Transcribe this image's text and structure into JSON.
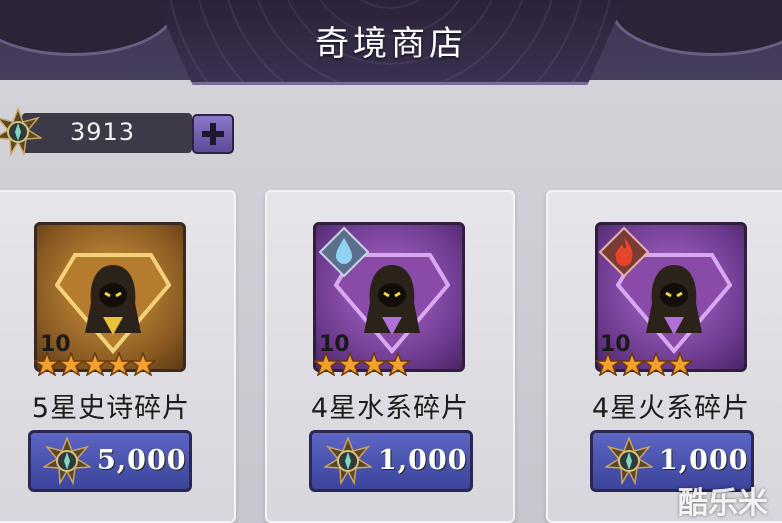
{
  "header": {
    "title": "奇境商店"
  },
  "currency": {
    "amount": "3913",
    "icon": "compass-coin-icon"
  },
  "items": [
    {
      "name": "5星史诗碎片",
      "level": "10",
      "stars": 5,
      "price": "5,000",
      "rarity_color": "#c78a35"
    },
    {
      "name": "4星水系碎片",
      "level": "10",
      "stars": 4,
      "price": "1,000",
      "element": "water-icon",
      "rarity_color": "#9a5bbf"
    },
    {
      "name": "4星火系碎片",
      "level": "10",
      "stars": 4,
      "price": "1,000",
      "element": "fire-icon",
      "rarity_color": "#9a5bbf"
    }
  ],
  "watermark": "酷乐米"
}
